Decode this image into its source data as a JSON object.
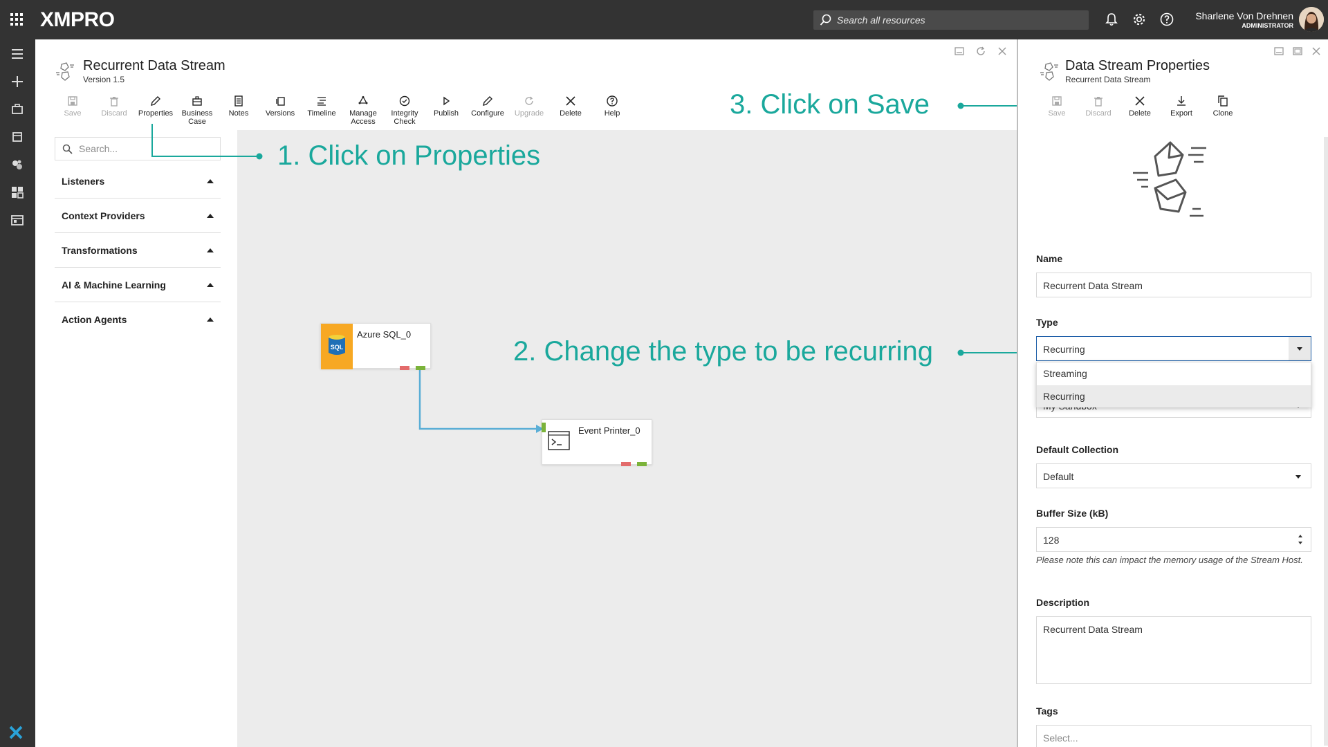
{
  "topbar": {
    "logo": "XMPRO",
    "search_placeholder": "Search all resources",
    "user_name": "Sharlene Von Drehnen",
    "user_role": "ADMINISTRATOR"
  },
  "editor": {
    "title": "Recurrent Data Stream",
    "version": "Version 1.5",
    "toolbar": [
      {
        "label": "Save",
        "icon": "save-icon",
        "disabled": true
      },
      {
        "label": "Discard",
        "icon": "trash-icon",
        "disabled": true
      },
      {
        "label": "Properties",
        "icon": "pencil-icon",
        "disabled": false
      },
      {
        "label": "Business Case",
        "icon": "briefcase-icon",
        "disabled": false
      },
      {
        "label": "Notes",
        "icon": "notes-icon",
        "disabled": false
      },
      {
        "label": "Versions",
        "icon": "versions-icon",
        "disabled": false
      },
      {
        "label": "Timeline",
        "icon": "timeline-icon",
        "disabled": false
      },
      {
        "label": "Manage Access",
        "icon": "access-icon",
        "disabled": false
      },
      {
        "label": "Integrity Check",
        "icon": "check-circle-icon",
        "disabled": false
      },
      {
        "label": "Publish",
        "icon": "play-icon",
        "disabled": false
      },
      {
        "label": "Configure",
        "icon": "pencil-icon",
        "disabled": false
      },
      {
        "label": "Upgrade",
        "icon": "refresh-icon",
        "disabled": true
      },
      {
        "label": "Delete",
        "icon": "close-icon",
        "disabled": false
      },
      {
        "label": "Help",
        "icon": "help-icon",
        "disabled": false
      }
    ]
  },
  "toolbox": {
    "search_placeholder": "Search...",
    "categories": [
      "Listeners",
      "Context Providers",
      "Transformations",
      "AI & Machine Learning",
      "Action Agents"
    ]
  },
  "canvas": {
    "nodes": [
      {
        "label": "Azure SQL_0",
        "icon": "sql-database-icon"
      },
      {
        "label": "Event Printer_0",
        "icon": "terminal-icon"
      }
    ]
  },
  "annotations": {
    "step1": "1. Click on Properties",
    "step2": "2. Change the type to be recurring",
    "step3": "3. Click on Save",
    "color": "#1aa89c"
  },
  "properties": {
    "title": "Data Stream Properties",
    "subtitle": "Recurrent Data Stream",
    "toolbar": [
      {
        "label": "Save",
        "icon": "save-icon",
        "disabled": true
      },
      {
        "label": "Discard",
        "icon": "trash-icon",
        "disabled": true
      },
      {
        "label": "Delete",
        "icon": "close-icon",
        "disabled": false
      },
      {
        "label": "Export",
        "icon": "download-icon",
        "disabled": false
      },
      {
        "label": "Clone",
        "icon": "copy-icon",
        "disabled": false
      }
    ],
    "name_label": "Name",
    "name_value": "Recurrent Data Stream",
    "type_label": "Type",
    "type_value": "Recurring",
    "type_options": [
      "Streaming",
      "Recurring"
    ],
    "collection_value": "My Sandbox",
    "default_collection_label": "Default Collection",
    "default_collection_value": "Default",
    "buffer_label": "Buffer Size (kB)",
    "buffer_value": "128",
    "buffer_note": "Please note this can impact the memory usage of the Stream Host.",
    "description_label": "Description",
    "description_value": "Recurrent Data Stream",
    "tags_label": "Tags",
    "tags_placeholder": "Select..."
  }
}
